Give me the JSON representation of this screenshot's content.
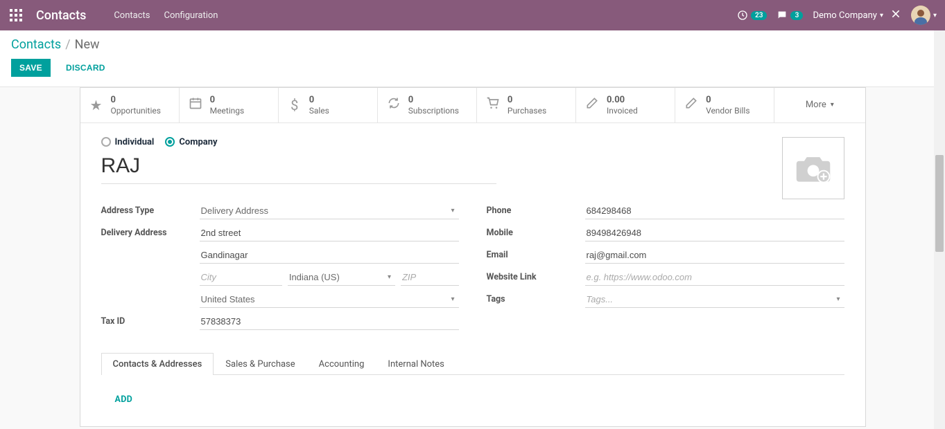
{
  "navbar": {
    "brand": "Contacts",
    "links": [
      "Contacts",
      "Configuration"
    ],
    "activity_count": "23",
    "message_count": "3",
    "company": "Demo Company"
  },
  "breadcrumb": {
    "parent": "Contacts",
    "current": "New"
  },
  "buttons": {
    "save": "SAVE",
    "discard": "DISCARD"
  },
  "stat_buttons": [
    {
      "value": "0",
      "label": "Opportunities"
    },
    {
      "value": "0",
      "label": "Meetings"
    },
    {
      "value": "0",
      "label": "Sales"
    },
    {
      "value": "0",
      "label": "Subscriptions"
    },
    {
      "value": "0",
      "label": "Purchases"
    },
    {
      "value": "0.00",
      "label": "Invoiced"
    },
    {
      "value": "0",
      "label": "Vendor Bills"
    }
  ],
  "more_label": "More",
  "form": {
    "radio": {
      "individual": "Individual",
      "company": "Company",
      "selected": "company"
    },
    "name": "RAJ",
    "labels": {
      "address_type": "Address Type",
      "delivery_address": "Delivery Address",
      "tax_id": "Tax ID",
      "phone": "Phone",
      "mobile": "Mobile",
      "email": "Email",
      "website": "Website Link",
      "tags": "Tags"
    },
    "values": {
      "address_type": "Delivery Address",
      "street": "2nd street",
      "street2": "Gandinagar",
      "city": "",
      "city_placeholder": "City",
      "state": "Indiana (US)",
      "zip": "",
      "zip_placeholder": "ZIP",
      "country": "United States",
      "tax_id": "57838373",
      "phone": "684298468",
      "mobile": "89498426948",
      "email": "raj@gmail.com",
      "website": "",
      "website_placeholder": "e.g. https://www.odoo.com",
      "tags": "",
      "tags_placeholder": "Tags..."
    }
  },
  "tabs": {
    "items": [
      "Contacts & Addresses",
      "Sales & Purchase",
      "Accounting",
      "Internal Notes"
    ],
    "active": 0,
    "add_label": "ADD"
  }
}
